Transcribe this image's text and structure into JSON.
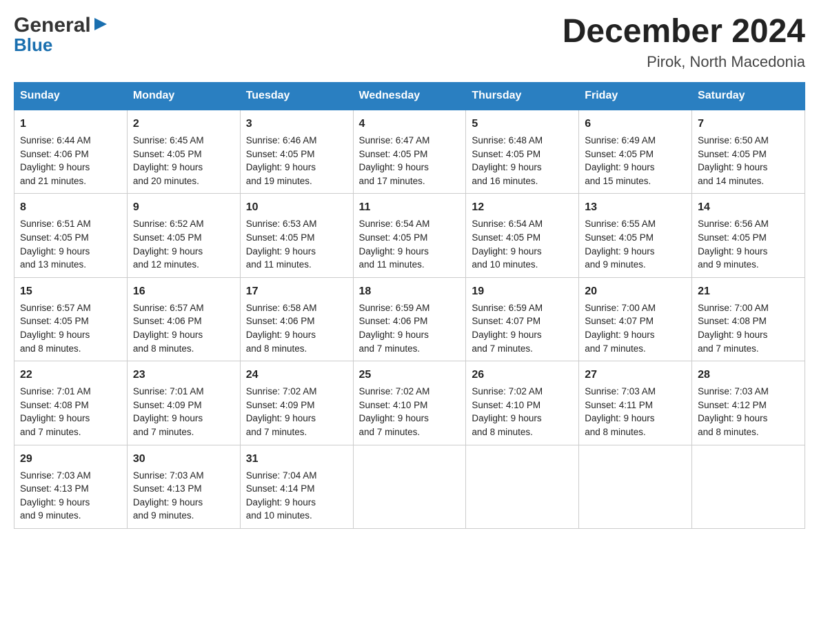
{
  "logo": {
    "general": "General",
    "blue": "Blue"
  },
  "header": {
    "month": "December 2024",
    "location": "Pirok, North Macedonia"
  },
  "days_header": [
    "Sunday",
    "Monday",
    "Tuesday",
    "Wednesday",
    "Thursday",
    "Friday",
    "Saturday"
  ],
  "weeks": [
    [
      {
        "day": "1",
        "sunrise": "6:44 AM",
        "sunset": "4:06 PM",
        "daylight": "9 hours and 21 minutes."
      },
      {
        "day": "2",
        "sunrise": "6:45 AM",
        "sunset": "4:05 PM",
        "daylight": "9 hours and 20 minutes."
      },
      {
        "day": "3",
        "sunrise": "6:46 AM",
        "sunset": "4:05 PM",
        "daylight": "9 hours and 19 minutes."
      },
      {
        "day": "4",
        "sunrise": "6:47 AM",
        "sunset": "4:05 PM",
        "daylight": "9 hours and 17 minutes."
      },
      {
        "day": "5",
        "sunrise": "6:48 AM",
        "sunset": "4:05 PM",
        "daylight": "9 hours and 16 minutes."
      },
      {
        "day": "6",
        "sunrise": "6:49 AM",
        "sunset": "4:05 PM",
        "daylight": "9 hours and 15 minutes."
      },
      {
        "day": "7",
        "sunrise": "6:50 AM",
        "sunset": "4:05 PM",
        "daylight": "9 hours and 14 minutes."
      }
    ],
    [
      {
        "day": "8",
        "sunrise": "6:51 AM",
        "sunset": "4:05 PM",
        "daylight": "9 hours and 13 minutes."
      },
      {
        "day": "9",
        "sunrise": "6:52 AM",
        "sunset": "4:05 PM",
        "daylight": "9 hours and 12 minutes."
      },
      {
        "day": "10",
        "sunrise": "6:53 AM",
        "sunset": "4:05 PM",
        "daylight": "9 hours and 11 minutes."
      },
      {
        "day": "11",
        "sunrise": "6:54 AM",
        "sunset": "4:05 PM",
        "daylight": "9 hours and 11 minutes."
      },
      {
        "day": "12",
        "sunrise": "6:54 AM",
        "sunset": "4:05 PM",
        "daylight": "9 hours and 10 minutes."
      },
      {
        "day": "13",
        "sunrise": "6:55 AM",
        "sunset": "4:05 PM",
        "daylight": "9 hours and 9 minutes."
      },
      {
        "day": "14",
        "sunrise": "6:56 AM",
        "sunset": "4:05 PM",
        "daylight": "9 hours and 9 minutes."
      }
    ],
    [
      {
        "day": "15",
        "sunrise": "6:57 AM",
        "sunset": "4:05 PM",
        "daylight": "9 hours and 8 minutes."
      },
      {
        "day": "16",
        "sunrise": "6:57 AM",
        "sunset": "4:06 PM",
        "daylight": "9 hours and 8 minutes."
      },
      {
        "day": "17",
        "sunrise": "6:58 AM",
        "sunset": "4:06 PM",
        "daylight": "9 hours and 8 minutes."
      },
      {
        "day": "18",
        "sunrise": "6:59 AM",
        "sunset": "4:06 PM",
        "daylight": "9 hours and 7 minutes."
      },
      {
        "day": "19",
        "sunrise": "6:59 AM",
        "sunset": "4:07 PM",
        "daylight": "9 hours and 7 minutes."
      },
      {
        "day": "20",
        "sunrise": "7:00 AM",
        "sunset": "4:07 PM",
        "daylight": "9 hours and 7 minutes."
      },
      {
        "day": "21",
        "sunrise": "7:00 AM",
        "sunset": "4:08 PM",
        "daylight": "9 hours and 7 minutes."
      }
    ],
    [
      {
        "day": "22",
        "sunrise": "7:01 AM",
        "sunset": "4:08 PM",
        "daylight": "9 hours and 7 minutes."
      },
      {
        "day": "23",
        "sunrise": "7:01 AM",
        "sunset": "4:09 PM",
        "daylight": "9 hours and 7 minutes."
      },
      {
        "day": "24",
        "sunrise": "7:02 AM",
        "sunset": "4:09 PM",
        "daylight": "9 hours and 7 minutes."
      },
      {
        "day": "25",
        "sunrise": "7:02 AM",
        "sunset": "4:10 PM",
        "daylight": "9 hours and 7 minutes."
      },
      {
        "day": "26",
        "sunrise": "7:02 AM",
        "sunset": "4:10 PM",
        "daylight": "9 hours and 8 minutes."
      },
      {
        "day": "27",
        "sunrise": "7:03 AM",
        "sunset": "4:11 PM",
        "daylight": "9 hours and 8 minutes."
      },
      {
        "day": "28",
        "sunrise": "7:03 AM",
        "sunset": "4:12 PM",
        "daylight": "9 hours and 8 minutes."
      }
    ],
    [
      {
        "day": "29",
        "sunrise": "7:03 AM",
        "sunset": "4:13 PM",
        "daylight": "9 hours and 9 minutes."
      },
      {
        "day": "30",
        "sunrise": "7:03 AM",
        "sunset": "4:13 PM",
        "daylight": "9 hours and 9 minutes."
      },
      {
        "day": "31",
        "sunrise": "7:04 AM",
        "sunset": "4:14 PM",
        "daylight": "9 hours and 10 minutes."
      },
      null,
      null,
      null,
      null
    ]
  ]
}
